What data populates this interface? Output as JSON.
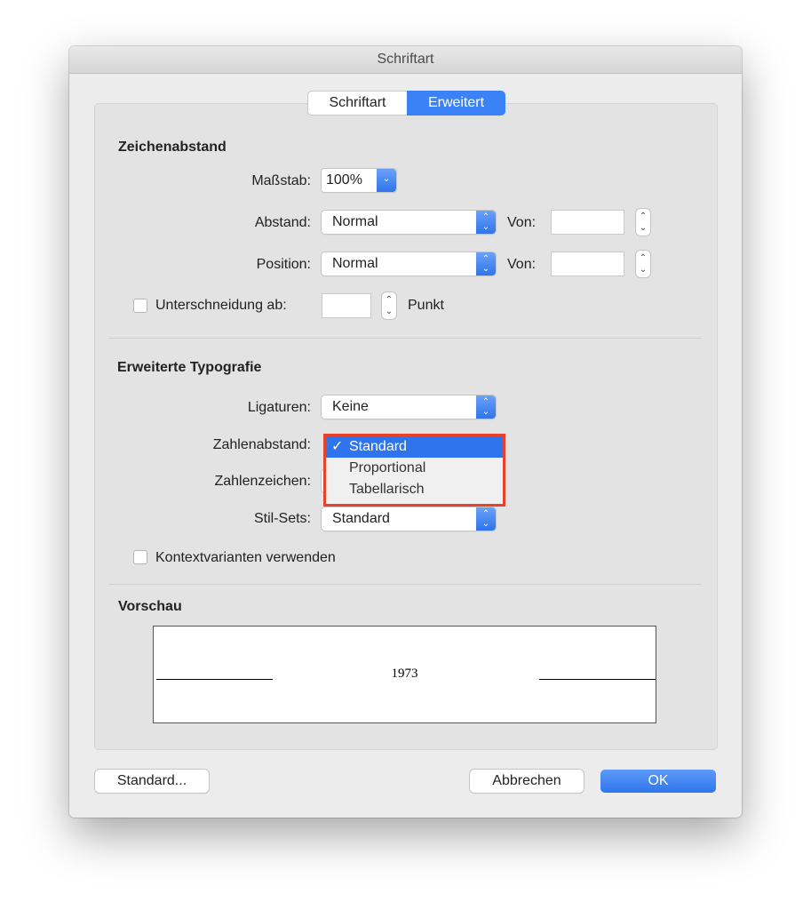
{
  "window": {
    "title": "Schriftart"
  },
  "tabs": [
    {
      "label": "Schriftart",
      "active": false
    },
    {
      "label": "Erweitert",
      "active": true
    }
  ],
  "spacing": {
    "heading": "Zeichenabstand",
    "scale_label": "Maßstab:",
    "scale_value": "100%",
    "spacing_label": "Abstand:",
    "spacing_value": "Normal",
    "spacing_by_label": "Von:",
    "spacing_by_value": "",
    "position_label": "Position:",
    "position_value": "Normal",
    "position_by_label": "Von:",
    "position_by_value": "",
    "kerning_label": "Unterschneidung ab:",
    "kerning_checked": false,
    "kerning_value": "",
    "kerning_unit": "Punkt"
  },
  "typography": {
    "heading": "Erweiterte Typografie",
    "ligatures_label": "Ligaturen:",
    "ligatures_value": "Keine",
    "number_spacing_label": "Zahlenabstand:",
    "number_spacing_options": [
      "Standard",
      "Proportional",
      "Tabellarisch"
    ],
    "number_spacing_selected": "Standard",
    "number_forms_label": "Zahlenzeichen:",
    "stylistic_sets_label": "Stil-Sets:",
    "stylistic_sets_value": "Standard",
    "contextual_label": "Kontextvarianten verwenden",
    "contextual_checked": false
  },
  "preview": {
    "heading": "Vorschau",
    "text": "1973"
  },
  "buttons": {
    "default": "Standard...",
    "cancel": "Abbrechen",
    "ok": "OK"
  },
  "colors": {
    "accent": "#2f74ec",
    "highlight_border": "#e8412c"
  }
}
